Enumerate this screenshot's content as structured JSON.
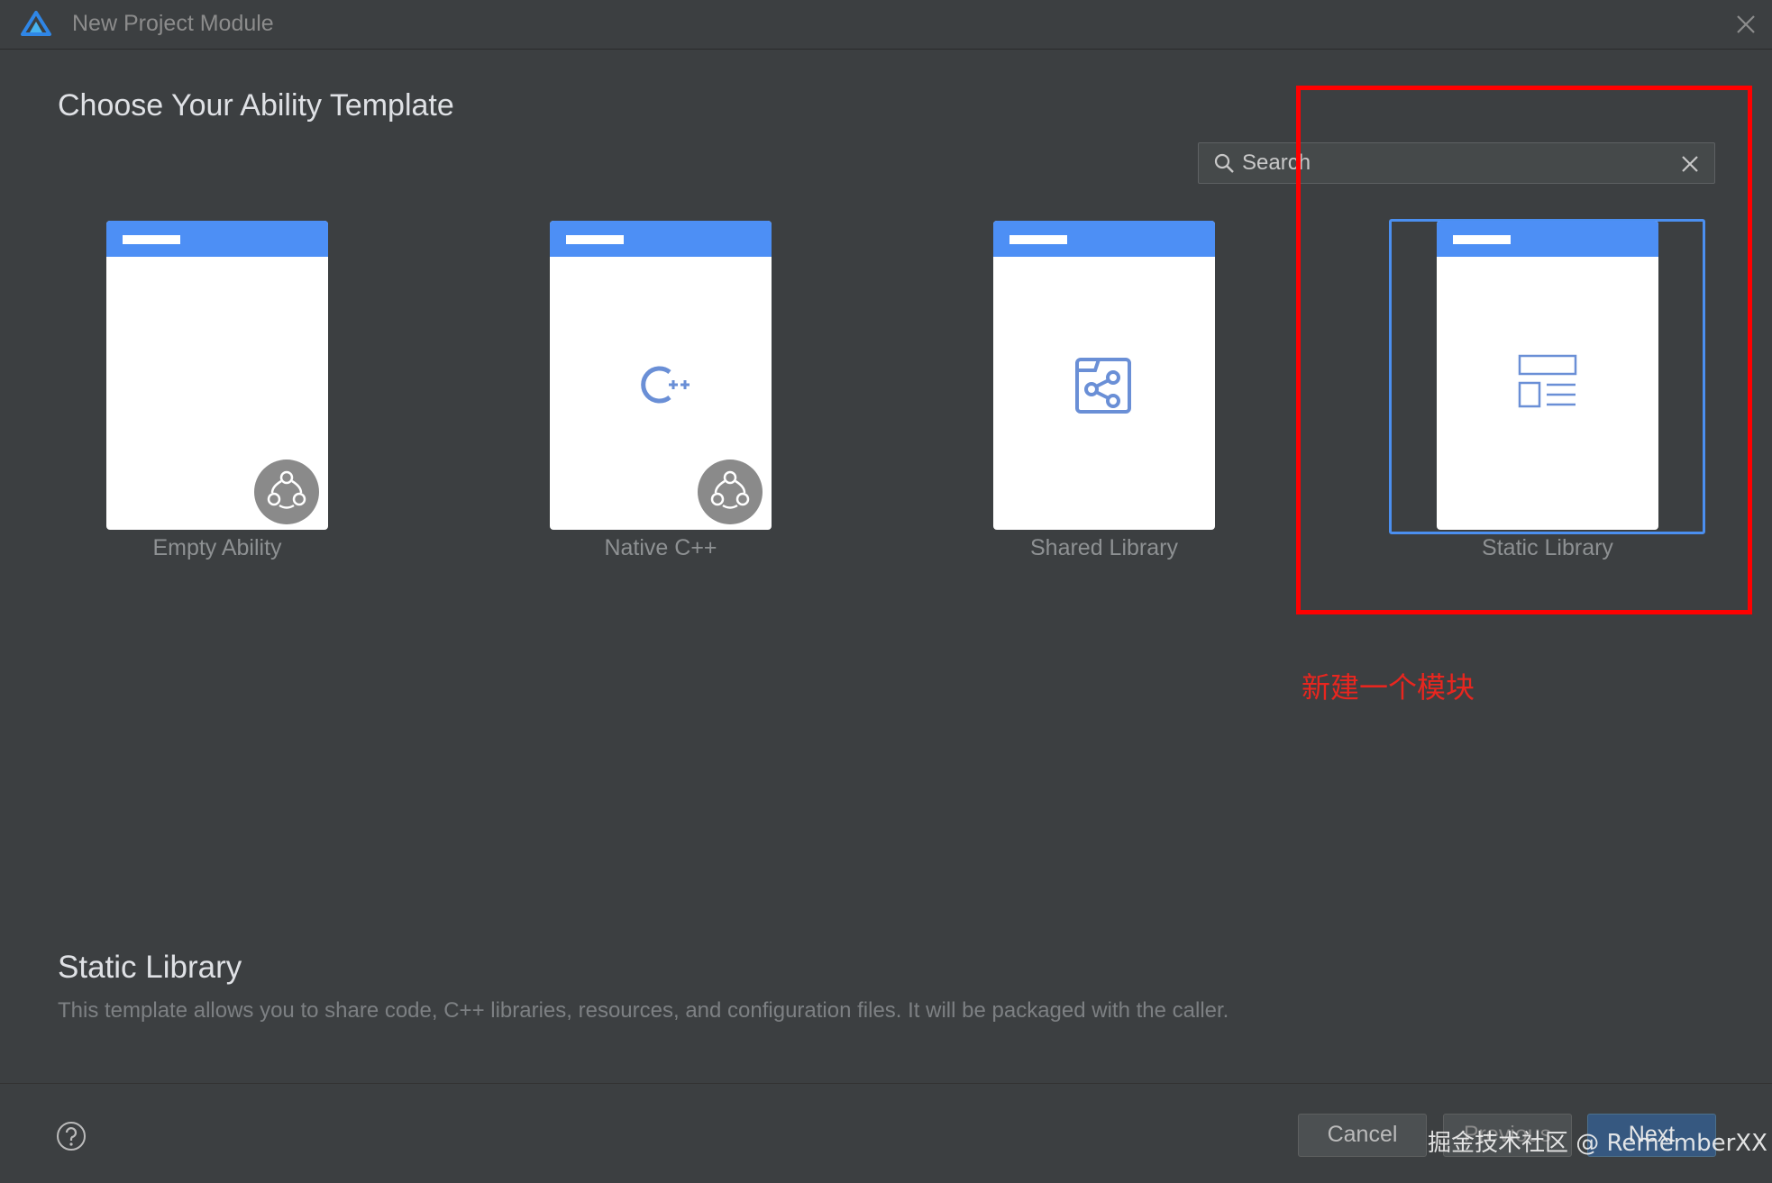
{
  "window": {
    "title": "New Project Module"
  },
  "heading": "Choose Your Ability Template",
  "search": {
    "placeholder": "Search",
    "value": ""
  },
  "templates": [
    {
      "label": "Empty Ability",
      "icon": "blank-icon",
      "badge": "ability-badge-icon"
    },
    {
      "label": "Native C++",
      "icon": "cpp-icon",
      "badge": "ability-badge-icon"
    },
    {
      "label": "Shared Library",
      "icon": "share-icon"
    },
    {
      "label": "Static Library",
      "icon": "layout-icon",
      "selected": true
    }
  ],
  "annotation": {
    "text": "新建一个模块",
    "color": "#ff0000"
  },
  "description": {
    "title": "Static Library",
    "text": "This template allows you to share code, C++ libraries, resources, and configuration files. It will be packaged with the caller."
  },
  "buttons": {
    "cancel": "Cancel",
    "previous": "Previous",
    "next": "Next"
  },
  "watermark": "掘金技术社区 @ RememberXX",
  "colors": {
    "background": "#3c3f41",
    "accent": "#4d8ff5",
    "selection": "#4b8ff0",
    "annotation": "#ff0000",
    "next_button": "#365880"
  }
}
